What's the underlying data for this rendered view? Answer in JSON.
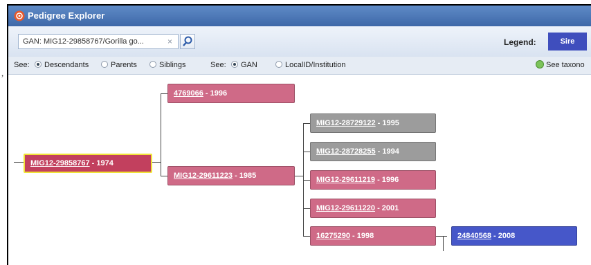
{
  "stray_char": ",",
  "window": {
    "title": "Pedigree Explorer"
  },
  "toolbar": {
    "search_value": "GAN: MIG12-29858767/Gorilla go...",
    "clear_symbol": "×",
    "legend_label": "Legend:",
    "legend_sire": "Sire"
  },
  "options": {
    "see_label_1": "See:",
    "descendants": "Descendants",
    "parents": "Parents",
    "siblings": "Siblings",
    "see_label_2": "See:",
    "gan": "GAN",
    "localid": "LocalID/Institution",
    "taxon_link": "See taxono"
  },
  "tree": {
    "root": {
      "id": "MIG12-29858767",
      "year": " - 1974"
    },
    "gen1": [
      {
        "id": "4769066",
        "year": " - 1996",
        "color": "#cf6a87"
      },
      {
        "id": "MIG12-29611223",
        "year": " - 1985",
        "color": "#cf6a87"
      }
    ],
    "gen2": [
      {
        "id": "MIG12-28729122",
        "year": " - 1995",
        "color": "#9c9c9c"
      },
      {
        "id": "MIG12-28728255",
        "year": " - 1994",
        "color": "#9c9c9c"
      },
      {
        "id": "MIG12-29611219",
        "year": " - 1996",
        "color": "#cf6a87"
      },
      {
        "id": "MIG12-29611220",
        "year": " - 2001",
        "color": "#cf6a87"
      },
      {
        "id": "16275290",
        "year": " - 1998",
        "color": "#cf6a87"
      }
    ],
    "gen3": [
      {
        "id": "24840568",
        "year": " - 2008",
        "color": "#4657c9"
      }
    ]
  }
}
